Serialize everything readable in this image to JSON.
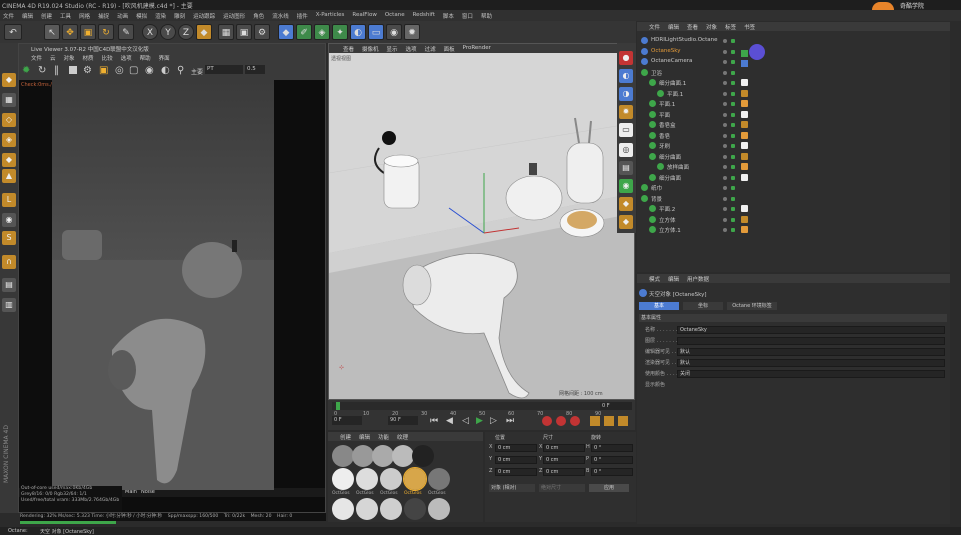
{
  "window_title": "CINEMA 4D R19.024 Studio (RC - R19) - [吹风机建模.c4d *] - 主要",
  "logo_text": "奇酷学院",
  "menu": [
    "文件",
    "编辑",
    "创建",
    "工具",
    "网格",
    "捕捉",
    "动画",
    "模拟",
    "渲染",
    "雕刻",
    "运动跟踪",
    "运动图形",
    "角色",
    "流水线",
    "插件",
    "X-Particles",
    "RealFlow",
    "Octane",
    "Redshift",
    "脚本",
    "窗口",
    "帮助"
  ],
  "toolbar": {
    "undo": "↶",
    "select": "↖",
    "move": "✥",
    "scale": "▣",
    "rotate": "↻",
    "x": "X",
    "y": "Y",
    "z": "Z"
  },
  "live_viewer": {
    "title": "Live Viewer 3.07-R2 中国C4D联盟中文汉化版",
    "menu": [
      "文件",
      "云",
      "对象",
      "材质",
      "比较",
      "选项",
      "帮助",
      "界面"
    ],
    "mode_label": "主要",
    "mode_value": "PT",
    "mode_num": "0.5",
    "stats": "Check:0ms./1ms. MeshGen:0ms. Update[C]:0ms. Nodes:58 Movable:29 0 0",
    "bottom": {
      "out_of_core": "Out-of-core used/max:0Kb/4Gb",
      "grey": "Grey8/16: 0/0",
      "rgb": "Rgb32/64: 1/1",
      "vram": "Used/free/total vram: 333Mb/2.764Gb/4Gb",
      "rendering": "Rendering: 32%  Ms/sec: 5.323   Time: 小时:分钟:秒 / 小时:分钟:秒",
      "spp": "Spp/maxspp: 160/500",
      "tri": "Tri: 0/22k",
      "mesh": "Mesh: 20",
      "hair": "Hair: 0",
      "tabs": [
        "Main",
        "Noise"
      ]
    }
  },
  "viewport": {
    "menu": [
      "查看",
      "摄像机",
      "显示",
      "选项",
      "过滤",
      "面板",
      "ProRender"
    ],
    "label": "透视视图",
    "grid_distance": "网格间距 : 100 cm"
  },
  "timeline": {
    "ticks": [
      "0",
      "10",
      "20",
      "30",
      "40",
      "50",
      "60",
      "70",
      "80",
      "90"
    ],
    "frame_end_label": "0 F",
    "start_field": "0 F",
    "end_field": "90 F",
    "current_field": "90 F"
  },
  "materials": {
    "menu": [
      "创建",
      "编辑",
      "功能",
      "纹理"
    ],
    "labels": [
      "OctGlos",
      "OctGlos",
      "OctGlos",
      "OctGlos",
      "OctGlos"
    ],
    "row2_label": "OctGlos"
  },
  "coords": {
    "headers": [
      "位置",
      "尺寸",
      "旋转"
    ],
    "rows": [
      {
        "axis": "X",
        "pos": "0 cm",
        "size_axis": "X",
        "size": "0 cm",
        "rot_axis": "H",
        "rot": "0 °"
      },
      {
        "axis": "Y",
        "pos": "0 cm",
        "size_axis": "Y",
        "size": "0 cm",
        "rot_axis": "P",
        "rot": "0 °"
      },
      {
        "axis": "Z",
        "pos": "0 cm",
        "size_axis": "Z",
        "size": "0 cm",
        "rot_axis": "B",
        "rot": "0 °"
      }
    ],
    "mode_select": "对象 (相对)",
    "size_select": "绝对尺寸",
    "apply": "应用"
  },
  "object_manager": {
    "menu": [
      "文件",
      "编辑",
      "查看",
      "对象",
      "标签",
      "书签"
    ],
    "objects": [
      {
        "name": "HDRILightStudio.Octane",
        "depth": 0,
        "color": "#c8c8c8"
      },
      {
        "name": "OctaneSky",
        "depth": 0,
        "color": "#e39b3a"
      },
      {
        "name": "OctaneCamera",
        "depth": 0,
        "color": "#c8c8c8"
      },
      {
        "name": "卫浴",
        "depth": 0,
        "color": "#c8c8c8"
      },
      {
        "name": "细分曲面.1",
        "depth": 1,
        "color": "#c8c8c8"
      },
      {
        "name": "平面.1",
        "depth": 2,
        "color": "#c8c8c8"
      },
      {
        "name": "平面.1",
        "depth": 1,
        "color": "#c8c8c8"
      },
      {
        "name": "平面",
        "depth": 1,
        "color": "#c8c8c8"
      },
      {
        "name": "香皂盒",
        "depth": 1,
        "color": "#c8c8c8"
      },
      {
        "name": "香皂",
        "depth": 1,
        "color": "#c8c8c8"
      },
      {
        "name": "牙刷",
        "depth": 1,
        "color": "#c8c8c8"
      },
      {
        "name": "细分曲面",
        "depth": 1,
        "color": "#c8c8c8"
      },
      {
        "name": "放样曲面",
        "depth": 2,
        "color": "#c8c8c8"
      },
      {
        "name": "细分曲面",
        "depth": 1,
        "color": "#c8c8c8"
      },
      {
        "name": "纸巾",
        "depth": 0,
        "color": "#c8c8c8"
      },
      {
        "name": "背景",
        "depth": 0,
        "color": "#c8c8c8"
      },
      {
        "name": "平面.2",
        "depth": 1,
        "color": "#c8c8c8"
      },
      {
        "name": "立方体",
        "depth": 1,
        "color": "#c8c8c8"
      },
      {
        "name": "立方体.1",
        "depth": 1,
        "color": "#c8c8c8"
      }
    ]
  },
  "attributes": {
    "menu": [
      "模式",
      "编辑",
      "用户数据"
    ],
    "object_title": "天空对象 [OctaneSky]",
    "tabs": [
      "基本",
      "坐标",
      "Octane 环境标签"
    ],
    "section": "基本属性",
    "fields": [
      {
        "label": "名称 . . . . . . .",
        "value": "OctaneSky"
      },
      {
        "label": "图层 . . . . . . .",
        "value": ""
      },
      {
        "label": "编辑器可见 . . .",
        "value": "默认"
      },
      {
        "label": "渲染器可见 . . .",
        "value": "默认"
      },
      {
        "label": "使用颜色 . . . .",
        "value": "关闭"
      },
      {
        "label": "显示颜色",
        "value": ""
      }
    ]
  },
  "status": {
    "app": "Octane:",
    "text": "天空 对象 [OctaneSky]"
  },
  "accent_colors": {
    "orange": "#e39b3a",
    "blue": "#4c7bd1",
    "green": "#3ea64a",
    "red": "#c23434"
  }
}
